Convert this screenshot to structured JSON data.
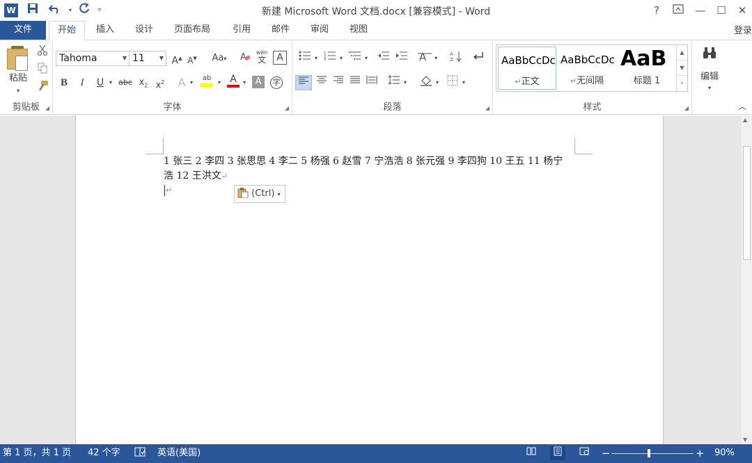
{
  "app": {
    "window_title": "新建 Microsoft Word 文档.docx [兼容模式] - Word",
    "word_icon_letter": "W",
    "help": "?",
    "sign_in": "登录"
  },
  "tabs": [
    {
      "label": "文件"
    },
    {
      "label": "开始"
    },
    {
      "label": "插入"
    },
    {
      "label": "设计"
    },
    {
      "label": "页面布局"
    },
    {
      "label": "引用"
    },
    {
      "label": "邮件"
    },
    {
      "label": "审阅"
    },
    {
      "label": "视图"
    }
  ],
  "clipboard": {
    "group_label": "剪贴板",
    "paste_label": "粘贴"
  },
  "font": {
    "group_label": "字体",
    "font_name": "Tahoma",
    "font_size": "11",
    "grow": "A",
    "shrink": "A",
    "change_case": "Aa",
    "phonetic": "wén",
    "phonetic_char": "文",
    "char_border": "A",
    "bold": "B",
    "italic": "I",
    "underline": "U",
    "strike": "abc",
    "subscript": "x",
    "superscript": "x",
    "text_effects": "A",
    "highlight": "ab",
    "font_color": "A",
    "char_shading": "A",
    "enclose": "字"
  },
  "paragraph": {
    "group_label": "段落"
  },
  "styles": {
    "group_label": "样式",
    "items": [
      {
        "sample": "AaBbCcDc",
        "name": "正文"
      },
      {
        "sample": "AaBbCcDc",
        "name": "无间隔"
      },
      {
        "sample": "AaB",
        "name": "标题 1"
      }
    ]
  },
  "editing": {
    "label": "编辑"
  },
  "document": {
    "text_line1": "1 张三 2 李四 3 张思思 4 李二 5 杨强 6 赵雪 7 宁浩浩 8 张元强 9 李四狗 10 王五 11 杨宁",
    "text_line2": "浩 12 王洪文",
    "paragraph_mark": "↵",
    "paste_options_label": "(Ctrl)"
  },
  "status": {
    "page": "第 1 页，共 1 页",
    "words": "42 个字",
    "language": "英语(美国)",
    "zoom": "90%",
    "zoom_minus": "−",
    "zoom_plus": "+"
  },
  "colors": {
    "brand": "#2b579a",
    "highlight_yellow": "#ffff00",
    "font_color_red": "#ff0000"
  }
}
